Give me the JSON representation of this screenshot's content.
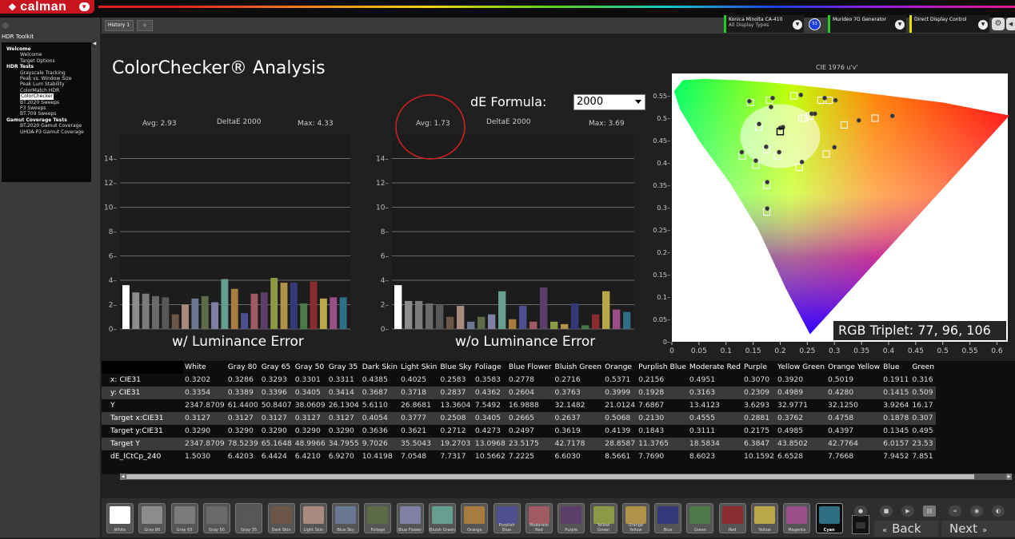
{
  "app": {
    "logo_text": "calman"
  },
  "sidebar": {
    "title": "HDR Toolkit",
    "items": [
      {
        "label": "Welcome",
        "level": 0
      },
      {
        "label": "Welcome",
        "level": 1
      },
      {
        "label": "Target Options",
        "level": 1
      },
      {
        "label": "HDR Tests",
        "level": 0
      },
      {
        "label": "Grayscale Tracking",
        "level": 1
      },
      {
        "label": "Peak vs. Window Size",
        "level": 1
      },
      {
        "label": "Peak Lum Stability",
        "level": 1
      },
      {
        "label": "ColorMatch HDR",
        "level": 1
      },
      {
        "label": "ColorChecker",
        "level": 1,
        "selected": true
      },
      {
        "label": "BT.2020 Sweeps",
        "level": 1
      },
      {
        "label": "P3 Sweeps",
        "level": 1
      },
      {
        "label": "BT.709 Sweeps",
        "level": 1
      },
      {
        "label": "Gamut Coverage Tests",
        "level": 0
      },
      {
        "label": "BT.2020 Gamut Coverage",
        "level": 1
      },
      {
        "label": "UHDA-P3 Gamut Coverage",
        "level": 1
      }
    ]
  },
  "tabs": {
    "history": "History 1",
    "add": "+"
  },
  "devices": {
    "meter_line1": "Konica Minolta CA-410",
    "meter_line2": "All Display Types",
    "meter_badge": "53",
    "generator": "Murideo 7G Generator",
    "display": "Direct Display Control",
    "colors": {
      "meter": "#22cc22",
      "generator": "#22cc22",
      "display": "#e0e000"
    }
  },
  "page": {
    "title": "ColorChecker® Analysis",
    "dE_formula_label": "dE Formula:",
    "dE_formula_value": "2000",
    "rgb_triplet": "RGB Triplet: 77, 96, 106"
  },
  "chart_data": [
    {
      "type": "bar",
      "title": "DeltaE 2000",
      "avg_label": "Avg: 2.93",
      "max_label": "Max: 4.33",
      "caption": "w/ Luminance Error",
      "ylim": [
        0,
        16
      ],
      "yticks": [
        0,
        2,
        4,
        6,
        8,
        10,
        12,
        14
      ],
      "categories": [
        "White",
        "Gray 80",
        "Gray 65",
        "Gray 50",
        "Gray 35",
        "Dark Skin",
        "Light Skin",
        "Blue Sky",
        "Foliage",
        "Blue Flower",
        "Bluish Green",
        "Orange",
        "Purplish Blue",
        "Moderate Red",
        "Purple",
        "Yellow Green",
        "Orange Yellow",
        "Blue",
        "Green",
        "Red",
        "Yellow",
        "Magenta",
        "Cyan"
      ],
      "values": [
        3.6,
        3.0,
        2.9,
        2.7,
        2.6,
        1.2,
        2.0,
        2.5,
        2.7,
        2.2,
        4.1,
        3.3,
        1.3,
        2.9,
        3.0,
        4.2,
        3.8,
        3.8,
        2.1,
        3.9,
        2.5,
        2.6,
        2.6
      ],
      "colors": [
        "#ffffff",
        "#8c8c8c",
        "#7c7c7c",
        "#6a6a6a",
        "#575757",
        "#6b5647",
        "#a88a7f",
        "#6a7891",
        "#5d6b48",
        "#7f80a3",
        "#669f8f",
        "#a87b3e",
        "#4d4f8e",
        "#a05a62",
        "#5b3f6a",
        "#8c9a45",
        "#b0924a",
        "#34397a",
        "#4b7a48",
        "#8a2c2f",
        "#b8a84a",
        "#9a4f88",
        "#2f6e85"
      ]
    },
    {
      "type": "bar",
      "title": "DeltaE 2000",
      "avg_label": "Avg: 1.73",
      "max_label": "Max: 3.69",
      "caption": "w/o Luminance Error",
      "ylim": [
        0,
        16
      ],
      "yticks": [
        0,
        2,
        4,
        6,
        8,
        10,
        12,
        14
      ],
      "values": [
        3.6,
        2.3,
        2.3,
        2.1,
        2.0,
        1.0,
        1.9,
        0.6,
        1.0,
        1.2,
        3.1,
        0.8,
        1.9,
        0.6,
        3.4,
        0.6,
        0.4,
        2.1,
        0.3,
        1.2,
        3.1,
        1.6,
        1.4
      ]
    },
    {
      "type": "scatter",
      "title": "CIE 1976 u'v'",
      "xlim": [
        0,
        0.62
      ],
      "ylim": [
        0,
        0.6
      ],
      "xticks": [
        "0",
        "0.05",
        "0.1",
        "0.15",
        "0.2",
        "0.25",
        "0.3",
        "0.35",
        "0.4",
        "0.45",
        "0.5",
        "0.55",
        "0.6"
      ],
      "yticks": [
        "0",
        "0.05",
        "0.1",
        "0.15",
        "0.2",
        "0.25",
        "0.3",
        "0.35",
        "0.4",
        "0.45",
        "0.5",
        "0.55"
      ],
      "targets": [
        [
          0.145,
          0.535
        ],
        [
          0.16,
          0.48
        ],
        [
          0.18,
          0.54
        ],
        [
          0.2,
          0.47
        ],
        [
          0.225,
          0.55
        ],
        [
          0.24,
          0.5
        ],
        [
          0.255,
          0.505
        ],
        [
          0.275,
          0.54
        ],
        [
          0.29,
          0.54
        ],
        [
          0.318,
          0.485
        ],
        [
          0.375,
          0.5
        ],
        [
          0.13,
          0.415
        ],
        [
          0.175,
          0.43
        ],
        [
          0.195,
          0.415
        ],
        [
          0.235,
          0.39
        ],
        [
          0.285,
          0.42
        ],
        [
          0.175,
          0.35
        ],
        [
          0.175,
          0.29
        ],
        [
          0.155,
          0.395
        ],
        [
          0.245,
          0.5
        ]
      ],
      "measured": [
        [
          0.143,
          0.538
        ],
        [
          0.161,
          0.487
        ],
        [
          0.186,
          0.545
        ],
        [
          0.2,
          0.478
        ],
        [
          0.238,
          0.552
        ],
        [
          0.258,
          0.51
        ],
        [
          0.264,
          0.51
        ],
        [
          0.282,
          0.545
        ],
        [
          0.302,
          0.54
        ],
        [
          0.345,
          0.495
        ],
        [
          0.407,
          0.505
        ],
        [
          0.129,
          0.424
        ],
        [
          0.174,
          0.436
        ],
        [
          0.198,
          0.424
        ],
        [
          0.24,
          0.402
        ],
        [
          0.3,
          0.435
        ],
        [
          0.176,
          0.357
        ],
        [
          0.176,
          0.298
        ],
        [
          0.155,
          0.405
        ],
        [
          0.183,
          0.525
        ],
        [
          0.205,
          0.48
        ]
      ]
    }
  ],
  "table": {
    "columns": [
      "",
      "White",
      "Gray 80",
      "Gray 65",
      "Gray 50",
      "Gray 35",
      "Dark Skin",
      "Light Skin",
      "Blue Sky",
      "Foliage",
      "Blue Flower",
      "Bluish Green",
      "Orange",
      "Purplish Blue",
      "Moderate Red",
      "Purple",
      "Yellow Green",
      "Orange Yellow",
      "Blue",
      "Green"
    ],
    "rows": [
      {
        "label": "x: CIE31",
        "values": [
          "0.3202",
          "0.3286",
          "0.3293",
          "0.3301",
          "0.3311",
          "0.4385",
          "0.4025",
          "0.2583",
          "0.3583",
          "0.2778",
          "0.2716",
          "0.5371",
          "0.2156",
          "0.4951",
          "0.3070",
          "0.3920",
          "0.5019",
          "0.1911",
          "0.316"
        ]
      },
      {
        "label": "y: CIE31",
        "values": [
          "0.3354",
          "0.3389",
          "0.3396",
          "0.3405",
          "0.3414",
          "0.3687",
          "0.3718",
          "0.2837",
          "0.4362",
          "0.2604",
          "0.3763",
          "0.3999",
          "0.1928",
          "0.3163",
          "0.2309",
          "0.4989",
          "0.4280",
          "0.1415",
          "0.509"
        ]
      },
      {
        "label": "Y",
        "values": [
          "2347.8709",
          "61.4400",
          "50.8407",
          "38.0609",
          "26.1304",
          "5.6110",
          "26.8681",
          "13.3604",
          "7.5492",
          "16.9888",
          "32.1482",
          "21.0124",
          "7.6867",
          "13.4123",
          "3.6293",
          "32.9771",
          "32.1250",
          "3.9264",
          "16.17"
        ]
      },
      {
        "label": "Target x:CIE31",
        "values": [
          "0.3127",
          "0.3127",
          "0.3127",
          "0.3127",
          "0.3127",
          "0.4054",
          "0.3777",
          "0.2508",
          "0.3405",
          "0.2665",
          "0.2637",
          "0.5068",
          "0.2130",
          "0.4555",
          "0.2881",
          "0.3762",
          "0.4758",
          "0.1878",
          "0.307"
        ]
      },
      {
        "label": "Target y:CIE31",
        "values": [
          "0.3290",
          "0.3290",
          "0.3290",
          "0.3290",
          "0.3290",
          "0.3636",
          "0.3621",
          "0.2712",
          "0.4273",
          "0.2497",
          "0.3619",
          "0.4139",
          "0.1843",
          "0.3111",
          "0.2175",
          "0.4985",
          "0.4397",
          "0.1345",
          "0.495"
        ]
      },
      {
        "label": "Target Y",
        "values": [
          "2347.8709",
          "78.5239",
          "65.1648",
          "48.9966",
          "34.7955",
          "9.7026",
          "35.5043",
          "19.2703",
          "13.0968",
          "23.5175",
          "42.7178",
          "28.8587",
          "11.3765",
          "18.5834",
          "6.3847",
          "43.8502",
          "42.7764",
          "6.0157",
          "23.53"
        ]
      },
      {
        "label": "dE_ICtCp_240",
        "values": [
          "1.5030",
          "6.4203",
          "6.4424",
          "6.4210",
          "6.9270",
          "10.4198",
          "7.0548",
          "7.7317",
          "10.5662",
          "7.2225",
          "6.6030",
          "8.5661",
          "7.7690",
          "8.6023",
          "10.1592",
          "6.6528",
          "7.7668",
          "7.9452",
          "7.851"
        ]
      }
    ]
  },
  "swatches": [
    {
      "label": "White",
      "color": "#ffffff"
    },
    {
      "label": "Gray 80",
      "color": "#8c8c8c"
    },
    {
      "label": "Gray 65",
      "color": "#7c7c7c"
    },
    {
      "label": "Gray 50",
      "color": "#6a6a6a"
    },
    {
      "label": "Gray 35",
      "color": "#575757"
    },
    {
      "label": "Dark Skin",
      "color": "#6b5647"
    },
    {
      "label": "Light Skin",
      "color": "#a88a7f"
    },
    {
      "label": "Blue Sky",
      "color": "#6a7891"
    },
    {
      "label": "Foliage",
      "color": "#5d6b48"
    },
    {
      "label": "Blue Flower",
      "color": "#7f80a3"
    },
    {
      "label": "Bluish Green",
      "color": "#669f8f"
    },
    {
      "label": "Orange",
      "color": "#a87b3e"
    },
    {
      "label": "Purplish Blue",
      "color": "#4d4f8e"
    },
    {
      "label": "Moderate Red",
      "color": "#a05a62"
    },
    {
      "label": "Purple",
      "color": "#5b3f6a"
    },
    {
      "label": "Yellow Green",
      "color": "#8c9a45"
    },
    {
      "label": "Orange Yellow",
      "color": "#b0924a"
    },
    {
      "label": "Blue",
      "color": "#34397a"
    },
    {
      "label": "Green",
      "color": "#4b7a48"
    },
    {
      "label": "Red",
      "color": "#8a2c2f"
    },
    {
      "label": "Yellow",
      "color": "#b8a84a"
    },
    {
      "label": "Magenta",
      "color": "#9a4f88"
    },
    {
      "label": "Cyan",
      "color": "#2f6e85",
      "active": true
    }
  ],
  "nav": {
    "back": "Back",
    "next": "Next"
  }
}
